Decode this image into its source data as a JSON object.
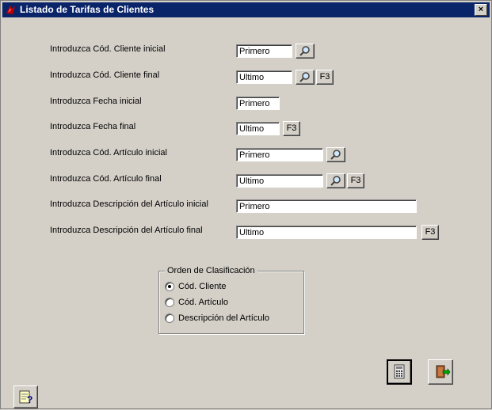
{
  "window": {
    "title": "Listado de Tarifas de Clientes",
    "close_label": "×"
  },
  "form": {
    "rows": [
      {
        "label": "Introduzca Cód. Cliente inicial",
        "value": "Primero"
      },
      {
        "label": "Introduzca Cód. Cliente final",
        "value": "Ultimo"
      },
      {
        "label": "Introduzca Fecha inicial",
        "value": "Primero"
      },
      {
        "label": "Introduzca Fecha final",
        "value": "Ultimo"
      },
      {
        "label": "Introduzca Cód. Artículo inicial",
        "value": "Primero"
      },
      {
        "label": "Introduzca Cód. Artículo final",
        "value": "Ultimo"
      },
      {
        "label": "Introduzca Descripción del Artículo inicial",
        "value": "Primero"
      },
      {
        "label": "Introduzca Descripción del Artículo final",
        "value": "Ultimo"
      }
    ],
    "f3_label": "F3"
  },
  "sort_group": {
    "title": "Orden de Clasificación",
    "options": [
      {
        "label": "Cód. Cliente",
        "selected": true
      },
      {
        "label": "Cód. Artículo",
        "selected": false
      },
      {
        "label": "Descripción del Artículo",
        "selected": false
      }
    ]
  },
  "icons": {
    "search": "magnifier-icon",
    "print": "calculator-print-icon",
    "exit": "exit-door-icon",
    "help": "help-icon",
    "app": "app-logo-icon"
  }
}
